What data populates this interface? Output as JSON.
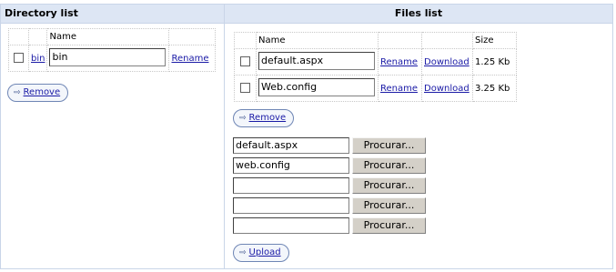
{
  "directory": {
    "title": "Directory list",
    "column_name": "Name",
    "rows": [
      {
        "link": "bin",
        "value": "bin",
        "rename": "Rename"
      }
    ],
    "remove_label": "Remove"
  },
  "files": {
    "title": "Files list",
    "columns": {
      "name": "Name",
      "size": "Size"
    },
    "rows": [
      {
        "value": "default.aspx",
        "rename": "Rename",
        "download": "Download",
        "size": "1.25 Kb"
      },
      {
        "value": "Web.config",
        "rename": "Rename",
        "download": "Download",
        "size": "3.25 Kb"
      }
    ],
    "remove_label": "Remove"
  },
  "upload": {
    "fields": [
      "default.aspx",
      "web.config",
      "",
      "",
      ""
    ],
    "browse_label": "Procurar...",
    "upload_label": "Upload"
  }
}
